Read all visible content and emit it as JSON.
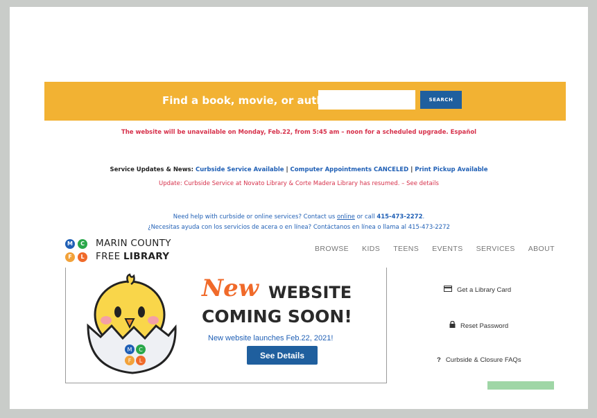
{
  "search": {
    "label": "Find a book, movie, or author:",
    "placeholder": "",
    "button_label": "SEARCH"
  },
  "notice": {
    "outage": "The website will be unavailable on Monday, Feb.22, from 5:45 am – noon for a scheduled upgrade. Español"
  },
  "service_updates": {
    "prefix": "Service Updates & News: ",
    "link1": "Curbside Service Available",
    "sep1": " | ",
    "link2": "Computer Appointments CANCELED",
    "sep2": " | ",
    "link3": "Print Pickup Available",
    "update_line": "Update: Curbside Service at Novato Library & Corte Madera Library has resumed. – See details"
  },
  "help": {
    "en_prefix": "Need help with curbside or online services? Contact us ",
    "en_link": "online",
    "en_mid": " or call ",
    "en_phone": "415-473-2272",
    "en_suffix": ".",
    "es": "¿Necesitas ayuda con los servicios de acera o en línea? Contáctanos en línea o llama al 415-473-2272"
  },
  "logo": {
    "line1": "MARIN COUNTY",
    "line2_a": "FREE ",
    "line2_b": "LIBRARY",
    "letters": [
      "M",
      "C",
      "F",
      "L"
    ]
  },
  "nav": {
    "items": [
      "BROWSE",
      "KIDS",
      "TEENS",
      "EVENTS",
      "SERVICES",
      "ABOUT"
    ]
  },
  "banner": {
    "new_word": "New",
    "website_word": "WEBSITE",
    "coming_soon": "COMING SOON!",
    "launch_text": "New website launches Feb.22, 2021!",
    "details_label": "See Details",
    "badge_letters": [
      "M",
      "C",
      "F",
      "L"
    ]
  },
  "sidebar": {
    "library_card": "Get a Library Card",
    "reset_password": "Reset Password",
    "faqs": "Curbside & Closure FAQs",
    "faq_icon_glyph": "?"
  },
  "colors": {
    "accent_orange": "#f2b233",
    "brand_blue": "#1f5f9e",
    "alert_red": "#d6304a",
    "new_orange": "#f06a2a"
  }
}
